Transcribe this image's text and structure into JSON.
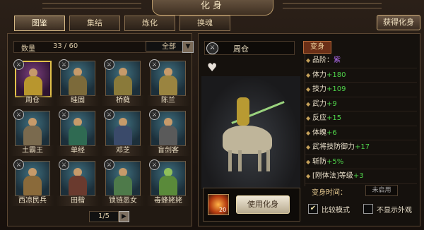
{
  "title": "化身",
  "tabs": [
    {
      "label": "图鉴",
      "active": true
    },
    {
      "label": "集结",
      "active": false
    },
    {
      "label": "炼化",
      "active": false
    },
    {
      "label": "换魂",
      "active": false
    }
  ],
  "get_button": "获得化身",
  "roster": {
    "count_label": "数量",
    "count_value": "33 / 60",
    "filter": "全部",
    "heroes": [
      {
        "name": "周仓",
        "selected": true
      },
      {
        "name": "眭固",
        "selected": false
      },
      {
        "name": "桥蕤",
        "selected": false
      },
      {
        "name": "陈兰",
        "selected": false
      },
      {
        "name": "土霸王",
        "selected": false
      },
      {
        "name": "单经",
        "selected": false
      },
      {
        "name": "邓芝",
        "selected": false
      },
      {
        "name": "盲剑客",
        "selected": false
      },
      {
        "name": "西凉民兵",
        "selected": false
      },
      {
        "name": "田楷",
        "selected": false
      },
      {
        "name": "锁链恶女",
        "selected": false
      },
      {
        "name": "毒蜂姥姥",
        "selected": false
      }
    ],
    "page": "1/5"
  },
  "detail": {
    "hero_name": "周仓",
    "stats_tab": "变身",
    "stats": [
      {
        "label": "品阶：",
        "value": "紫",
        "style": "purple"
      },
      {
        "label": "体力",
        "value": "+180",
        "style": "plus"
      },
      {
        "label": "技力",
        "value": "+109",
        "style": "plus"
      },
      {
        "label": "武力",
        "value": "+9",
        "style": "plus"
      },
      {
        "label": "反应",
        "value": "+15",
        "style": "plus"
      },
      {
        "label": "体魄",
        "value": "+6",
        "style": "plus"
      },
      {
        "label": "武将技防御力",
        "value": "+17",
        "style": "plus"
      },
      {
        "label": "斩防",
        "value": "+5%",
        "style": "plus"
      },
      {
        "label": "[刚体法]等级",
        "value": "+3",
        "style": "plus"
      }
    ],
    "time_label": "变身时间：",
    "time_value": "未启用",
    "item_count": "20",
    "use_button": "使用化身",
    "compare_label": "比较模式",
    "compare_checked": true,
    "hide_label": "不显示外观",
    "hide_checked": false
  }
}
